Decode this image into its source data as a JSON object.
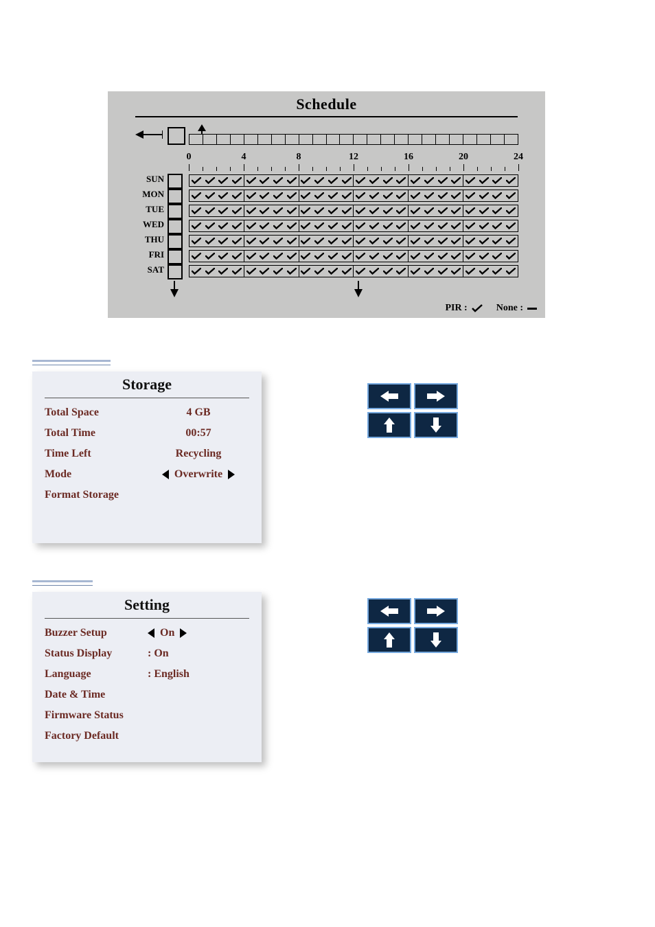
{
  "schedule": {
    "title": "Schedule",
    "hour_labels": [
      "0",
      "4",
      "8",
      "12",
      "16",
      "20",
      "24"
    ],
    "days": [
      {
        "label": "SUN"
      },
      {
        "label": "MON"
      },
      {
        "label": "TUE"
      },
      {
        "label": "WED"
      },
      {
        "label": "THU"
      },
      {
        "label": "FRI"
      },
      {
        "label": "SAT"
      }
    ],
    "legend": {
      "pir_label": "PIR :",
      "none_label": "None :"
    }
  },
  "storage": {
    "title": "Storage",
    "items": {
      "total_space": {
        "label": "Total Space",
        "value": "4 GB"
      },
      "total_time": {
        "label": "Total Time",
        "value": "00:57"
      },
      "time_left": {
        "label": "Time Left",
        "value": "Recycling"
      },
      "mode": {
        "label": "Mode",
        "value": "Overwrite"
      },
      "format_storage": {
        "label": "Format Storage"
      }
    }
  },
  "setting": {
    "title": "Setting",
    "items": {
      "buzzer_setup": {
        "label": "Buzzer Setup",
        "value": "On"
      },
      "status_display": {
        "label": "Status Display",
        "value": ": On"
      },
      "language": {
        "label": "Language",
        "value": ": English"
      },
      "date_time": {
        "label": "Date & Time"
      },
      "firmware_status": {
        "label": "Firmware Status"
      },
      "factory_default": {
        "label": "Factory Default"
      }
    }
  }
}
